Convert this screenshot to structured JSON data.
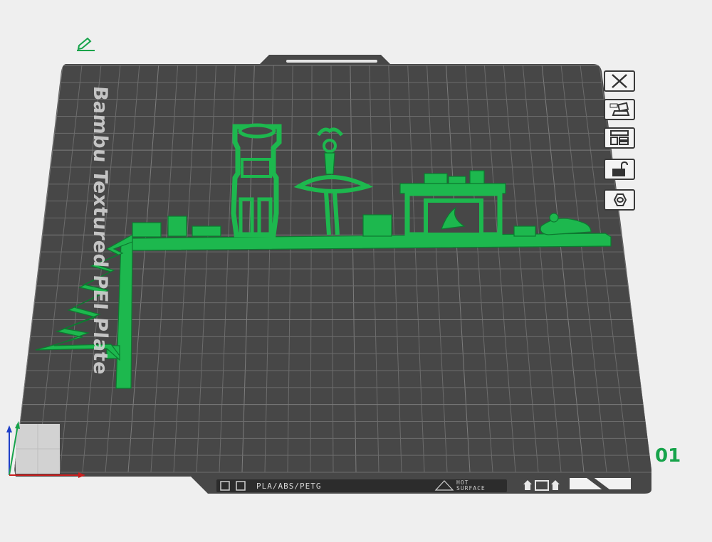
{
  "plate": {
    "label": "Bambu Textured PEI Plate",
    "number": "01",
    "material_strip": "PLA/ABS/PETG",
    "hot_surface_line1": "HOT",
    "hot_surface_line2": "SURFACE"
  },
  "toolbar": {
    "buttons": [
      {
        "name": "close-icon"
      },
      {
        "name": "auto-orient-icon"
      },
      {
        "name": "arrange-icon"
      },
      {
        "name": "lock-icon"
      },
      {
        "name": "plate-settings-icon"
      }
    ]
  },
  "icons": {
    "edit": "pencil-icon",
    "axes": "axes-gizmo-icon"
  },
  "colors": {
    "background": "#efefef",
    "plate": "#474747",
    "grid": "#6a6a6a",
    "model": "#16a34a",
    "accent": "#16a34a"
  }
}
